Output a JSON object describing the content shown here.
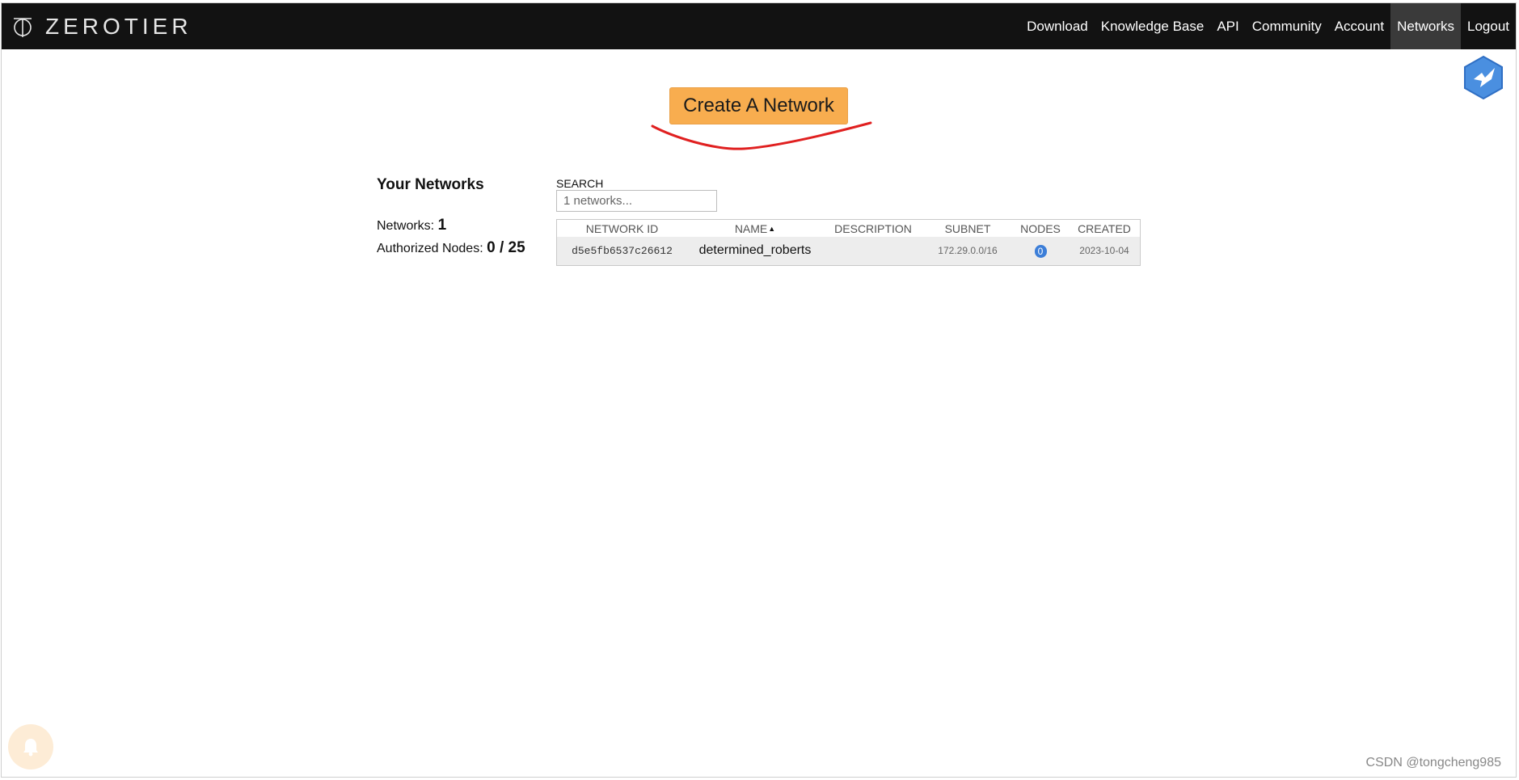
{
  "brand": {
    "name": "ZEROTIER",
    "logo_icon": "zerotier-logo-icon"
  },
  "nav": {
    "items": [
      {
        "label": "Download",
        "active": false
      },
      {
        "label": "Knowledge Base",
        "active": false
      },
      {
        "label": "API",
        "active": false
      },
      {
        "label": "Community",
        "active": false
      },
      {
        "label": "Account",
        "active": false
      },
      {
        "label": "Networks",
        "active": true
      },
      {
        "label": "Logout",
        "active": false
      }
    ]
  },
  "create_button": {
    "label": "Create A Network",
    "color": "#f8ad4f"
  },
  "summary": {
    "title": "Your Networks",
    "networks_label": "Networks:",
    "networks_count": "1",
    "nodes_label": "Authorized Nodes:",
    "nodes_value": "0 / 25"
  },
  "search": {
    "label": "SEARCH",
    "placeholder": "1 networks..."
  },
  "table": {
    "columns": [
      "NETWORK ID",
      "NAME",
      "DESCRIPTION",
      "SUBNET",
      "NODES",
      "CREATED"
    ],
    "sort_column": "NAME",
    "rows": [
      {
        "network_id": "d5e5fb6537c26612",
        "name": "determined_roberts",
        "description": "",
        "subnet": "172.29.0.0/16",
        "nodes": "0",
        "created": "2023-10-04"
      }
    ]
  },
  "floating_icon": "bird-hexagon-icon",
  "bell_icon": "bell-icon",
  "watermark": "CSDN @tongcheng985",
  "colors": {
    "nav_bg": "#121212",
    "accent_orange": "#f8ad4f",
    "badge_blue": "#3c7ed8",
    "annotation_red": "#e02020"
  }
}
